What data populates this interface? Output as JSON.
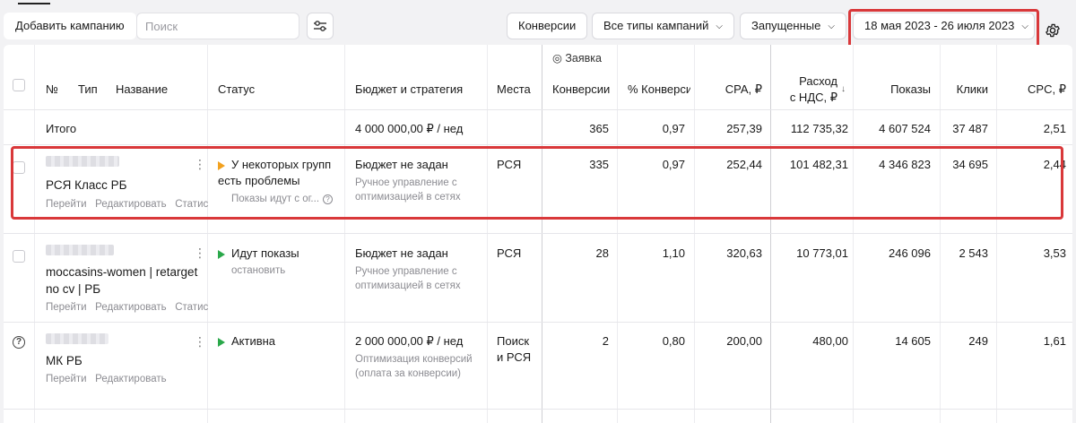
{
  "toolbar": {
    "add_campaign": "Добавить кампанию",
    "search_placeholder": "Поиск",
    "conversions": "Конверсии",
    "campaign_types": "Все типы кампаний",
    "status_filter": "Запущенные",
    "date_range": "18 мая 2023 - 26 июля 2023"
  },
  "header": {
    "goal": "◎ Заявка",
    "no": "№",
    "type": "Тип",
    "name": "Название",
    "status": "Статус",
    "budget": "Бюджет и стратегия",
    "places": "Места",
    "conversions": "Конверсии",
    "conv_rate": "% Конверсии",
    "cpa": "CPA, ₽",
    "spend_line1": "Расход",
    "spend_line2": "с НДС, ₽",
    "sort_arrow": "↓",
    "impressions": "Показы",
    "clicks": "Клики",
    "cpc": "CPC, ₽"
  },
  "total": {
    "label": "Итого",
    "budget": "4 000 000,00 ₽ / нед",
    "conversions": "365",
    "conv_rate": "0,97",
    "cpa": "257,39",
    "spend": "112 735,32",
    "impressions": "4 607 524",
    "clicks": "37 487",
    "cpc": "2,51"
  },
  "rows": [
    {
      "name": "РСЯ Класс РБ",
      "actions": {
        "go": "Перейти",
        "edit": "Редактировать",
        "stats": "Статис"
      },
      "status_line1": "У некоторых групп",
      "status_line2": "есть проблемы",
      "status_sub": "Показы идут с ог...",
      "budget": "Бюджет не задан",
      "strategy_line1": "Ручное управление с",
      "strategy_line2": "оптимизацией в сетях",
      "places": "РСЯ",
      "conversions": "335",
      "conv_rate": "0,97",
      "cpa": "252,44",
      "spend": "101 482,31",
      "impressions": "4 346 823",
      "clicks": "34 695",
      "cpc": "2,44"
    },
    {
      "name_line1": "moccasins-women | retarget",
      "name_line2": "no cv | РБ",
      "actions": {
        "go": "Перейти",
        "edit": "Редактировать",
        "stats": "Статис"
      },
      "status_line1": "Идут показы",
      "status_sub": "остановить",
      "budget": "Бюджет не задан",
      "strategy_line1": "Ручное управление с",
      "strategy_line2": "оптимизацией в сетях",
      "places": "РСЯ",
      "conversions": "28",
      "conv_rate": "1,10",
      "cpa": "320,63",
      "spend": "10 773,01",
      "impressions": "246 096",
      "clicks": "2 543",
      "cpc": "3,53"
    },
    {
      "name": "МК РБ",
      "actions": {
        "go": "Перейти",
        "edit": "Редактировать"
      },
      "status_line1": "Активна",
      "budget": "2 000 000,00 ₽ / нед",
      "strategy_line1": "Оптимизация конверсий",
      "strategy_line2": "(оплата за конверсии)",
      "places_line1": "Поиск",
      "places_line2": "и РСЯ",
      "conversions": "2",
      "conv_rate": "0,80",
      "cpa": "200,00",
      "spend": "480,00",
      "impressions": "14 605",
      "clicks": "249",
      "cpc": "1,61"
    }
  ],
  "colors": {
    "highlight": "#d9383a",
    "active": "#2aa84a",
    "warning": "#f2a11f"
  }
}
